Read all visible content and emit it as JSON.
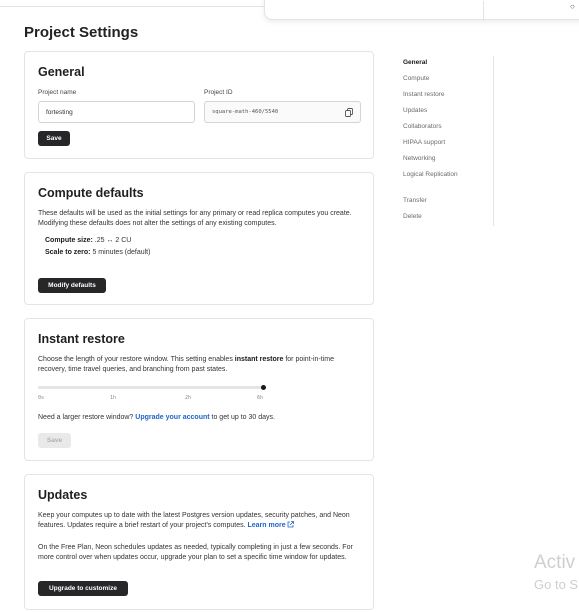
{
  "page": {
    "title": "Project Settings"
  },
  "general": {
    "heading": "General",
    "project_name_label": "Project name",
    "project_name_value": "fortesting",
    "project_id_label": "Project ID",
    "project_id_value": "square-math-460/5540",
    "save_label": "Save"
  },
  "compute": {
    "heading": "Compute defaults",
    "description": "These defaults will be used as the initial settings for any primary or read replica computes you create. Modifying these defaults does not alter the settings of any existing computes.",
    "size_label": "Compute size:",
    "size_value": ".25 ↔ 2 CU",
    "scale_label": "Scale to zero:",
    "scale_value": "5 minutes (default)",
    "button_label": "Modify defaults"
  },
  "restore": {
    "heading": "Instant restore",
    "desc_part1": "Choose the length of your restore window. This setting enables ",
    "desc_bold": "instant restore",
    "desc_part2": " for point-in-time recovery, time travel queries, and branching from past states.",
    "ticks": [
      "0s",
      "1h",
      "2h",
      "6h"
    ],
    "slider_level": 1.0,
    "upgrade_prefix": "Need a larger restore window? ",
    "upgrade_link": "Upgrade your account",
    "upgrade_suffix": " to get up to 30 days.",
    "save_label": "Save"
  },
  "updates": {
    "heading": "Updates",
    "desc": "Keep your computes up to date with the latest Postgres version updates, security patches, and Neon features. Updates require a brief restart of your project's computes. ",
    "learn_more": "Learn more",
    "free_plan_text": "On the Free Plan, Neon schedules updates as needed, typically completing in just a few seconds. For more control over when updates occur, upgrade your plan to set a specific time window for updates.",
    "button_label": "Upgrade to customize"
  },
  "nav": {
    "items": [
      "General",
      "Compute",
      "Instant restore",
      "Updates",
      "Collaborators",
      "HIPAA support",
      "Networking",
      "Logical Replication",
      "Transfer",
      "Delete"
    ],
    "active_index": 0
  },
  "watermark": {
    "line1": "Activ",
    "line2": "Go to S"
  },
  "icons": {
    "copy": "copy-icon",
    "external": "external-link-icon"
  }
}
